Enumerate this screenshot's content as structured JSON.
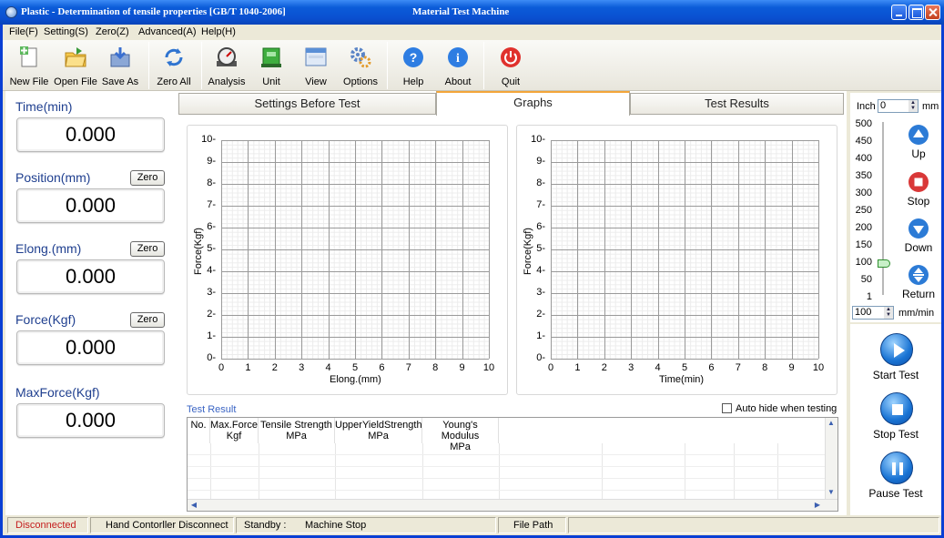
{
  "window": {
    "title": "Plastic - Determination of tensile properties [GB/T 1040-2006]",
    "center_title": "Material Test Machine"
  },
  "menu": [
    "File(F)",
    "Setting(S)",
    "Zero(Z)",
    "Advanced(A)",
    "Help(H)"
  ],
  "toolbar": {
    "new_file": "New File",
    "open_file": "Open File",
    "save_as": "Save As",
    "zero_all": "Zero All",
    "analysis": "Analysis",
    "unit": "Unit",
    "view": "View",
    "options": "Options",
    "help": "Help",
    "about": "About",
    "quit": "Quit"
  },
  "readouts": {
    "time": {
      "label": "Time(min)",
      "value": "0.000"
    },
    "position": {
      "label": "Position(mm)",
      "value": "0.000",
      "zero": "Zero"
    },
    "elong": {
      "label": "Elong.(mm)",
      "value": "0.000",
      "zero": "Zero"
    },
    "force": {
      "label": "Force(Kgf)",
      "value": "0.000",
      "zero": "Zero"
    },
    "maxforce": {
      "label": "MaxForce(Kgf)",
      "value": "0.000"
    }
  },
  "tabs": {
    "settings": "Settings Before Test",
    "graphs": "Graphs",
    "results": "Test Results"
  },
  "chart_data": [
    {
      "type": "line",
      "xlabel": "Elong.(mm)",
      "ylabel": "Force(Kgf)",
      "xlim": [
        0,
        10
      ],
      "ylim": [
        0,
        10
      ],
      "x_ticks": [
        "0",
        "1",
        "2",
        "3",
        "4",
        "5",
        "6",
        "7",
        "8",
        "9",
        "10"
      ],
      "y_ticks": [
        "0",
        "1",
        "2",
        "3",
        "4",
        "5",
        "6",
        "7",
        "8",
        "9",
        "10"
      ],
      "grid": true,
      "series": []
    },
    {
      "type": "line",
      "xlabel": "Time(min)",
      "ylabel": "Force(Kgf)",
      "xlim": [
        0,
        10
      ],
      "ylim": [
        0,
        10
      ],
      "x_ticks": [
        "0",
        "1",
        "2",
        "3",
        "4",
        "5",
        "6",
        "7",
        "8",
        "9",
        "10"
      ],
      "y_ticks": [
        "0",
        "1",
        "2",
        "3",
        "4",
        "5",
        "6",
        "7",
        "8",
        "9",
        "10"
      ],
      "grid": true,
      "series": []
    }
  ],
  "result": {
    "label": "Test Result",
    "auto_hide": "Auto hide when testing",
    "columns": [
      {
        "l1": "No.",
        "l2": ""
      },
      {
        "l1": "Max.Force",
        "l2": "Kgf"
      },
      {
        "l1": "Tensile Strength",
        "l2": "MPa"
      },
      {
        "l1": "UpperYieldStrength",
        "l2": "MPa"
      },
      {
        "l1": "Young's Modulus",
        "l2": "MPa"
      }
    ]
  },
  "right": {
    "inch_label": "Inch",
    "inch_value": "0",
    "mm_label": "mm",
    "scale": [
      "500",
      "450",
      "400",
      "350",
      "300",
      "250",
      "200",
      "150",
      "100",
      "50",
      "1"
    ],
    "speed_value": "100",
    "speed_unit": "mm/min",
    "speed_level": 100,
    "up": "Up",
    "stop": "Stop",
    "down": "Down",
    "return": "Return",
    "start_test": "Start Test",
    "stop_test": "Stop Test",
    "pause_test": "Pause Test"
  },
  "status": {
    "connection": "Disconnected",
    "hand": "Hand Contorller Disconnect",
    "standby": "Standby :",
    "machine": "Machine Stop",
    "file_path": "File Path"
  },
  "colors": {
    "disconnected": "#c41c1c",
    "label_blue": "#1f3f8f",
    "accent_tab": "#f3a53a"
  }
}
